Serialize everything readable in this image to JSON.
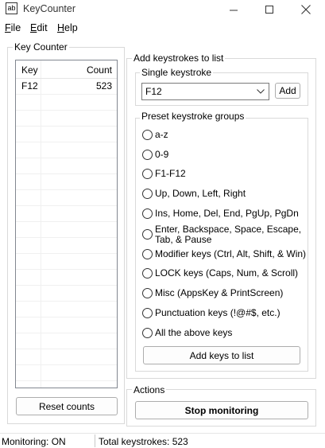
{
  "window": {
    "title": "KeyCounter",
    "icon_text": "ab"
  },
  "menu": [
    {
      "label": "File",
      "accel": "F",
      "rest": "ile"
    },
    {
      "label": "Edit",
      "accel": "E",
      "rest": "dit"
    },
    {
      "label": "Help",
      "accel": "H",
      "rest": "elp"
    }
  ],
  "key_counter": {
    "group_label": "Key Counter",
    "columns": {
      "key": "Key",
      "count": "Count"
    },
    "rows": [
      {
        "key": "F12",
        "count": "523"
      }
    ],
    "reset_label": "Reset counts"
  },
  "add_keystrokes": {
    "group_label": "Add keystrokes to list",
    "single": {
      "group_label": "Single keystroke",
      "selected": "F12",
      "add_label": "Add"
    },
    "presets": {
      "group_label": "Preset keystroke groups",
      "options": [
        "a-z",
        "0-9",
        "F1-F12",
        "Up, Down, Left, Right",
        "Ins, Home, Del, End, PgUp, PgDn",
        "Enter, Backspace, Space, Escape,\nTab, & Pause",
        "Modifier keys (Ctrl, Alt, Shift, & Win)",
        "LOCK keys (Caps, Num, & Scroll)",
        "Misc (AppsKey & PrintScreen)",
        "Punctuation keys (!@#$, etc.)",
        "All the above keys"
      ],
      "add_keys_label": "Add keys to list"
    }
  },
  "actions": {
    "group_label": "Actions",
    "stop_label": "Stop monitoring"
  },
  "status": {
    "monitoring": "Monitoring: ON",
    "total": "Total keystrokes: 523"
  }
}
